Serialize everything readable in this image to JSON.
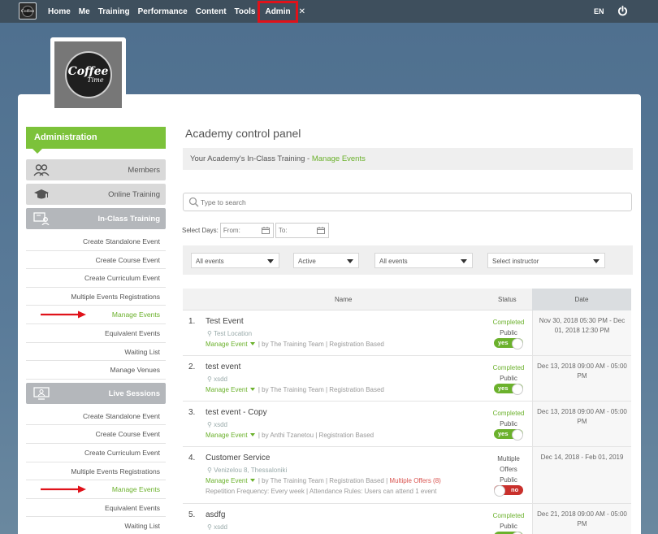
{
  "topbar": {
    "logo_text": "Coffee",
    "nav": [
      "Home",
      "Me",
      "Training",
      "Performance",
      "Content",
      "Tools"
    ],
    "admin": "Admin",
    "lang": "EN"
  },
  "profile": {
    "logo_line1": "Coffee",
    "logo_line2": "Time"
  },
  "sidebar": {
    "title": "Administration",
    "sections": {
      "members": "Members",
      "online": "Online Training",
      "inclass": "In-Class Training",
      "live": "Live Sessions"
    },
    "inclass_items": [
      "Create Standalone Event",
      "Create Course Event",
      "Create Curriculum Event",
      "Multiple Events Registrations",
      "Manage Events",
      "Equivalent Events",
      "Waiting List",
      "Manage Venues"
    ],
    "live_items": [
      "Create Standalone Event",
      "Create Course Event",
      "Create Curriculum Event",
      "Multiple Events Registrations",
      "Manage Events",
      "Equivalent Events",
      "Waiting List"
    ]
  },
  "main": {
    "title": "Academy control panel",
    "crumb_text": "Your Academy's In-Class Training - ",
    "crumb_link": "Manage Events",
    "search_placeholder": "Type to search",
    "select_days": "Select Days:",
    "from": "From:",
    "to": "To:",
    "filters": [
      "All events",
      "Active",
      "All events",
      "Select instructor"
    ]
  },
  "table": {
    "headers": {
      "name": "Name",
      "status": "Status",
      "date": "Date"
    },
    "rows": [
      {
        "num": "1.",
        "name": "Test Event",
        "location": "Test Location",
        "manage": "Manage Event",
        "by": " | by The Training Team | Registration Based",
        "extra": "",
        "freq": "",
        "status1": "Completed",
        "status2": "Public",
        "toggle": "yes",
        "date": "Nov 30, 2018 05:30 PM - Dec 01, 2018 12:30 PM"
      },
      {
        "num": "2.",
        "name": "test event",
        "location": "xsdd",
        "manage": "Manage Event",
        "by": " | by The Training Team | Registration Based",
        "extra": "",
        "freq": "",
        "status1": "Completed",
        "status2": "Public",
        "toggle": "yes",
        "date": "Dec 13, 2018 09:00 AM - 05:00 PM"
      },
      {
        "num": "3.",
        "name": "test event - Copy",
        "location": "xsdd",
        "manage": "Manage Event",
        "by": " | by Anthi Tzanetou | Registration Based",
        "extra": "",
        "freq": "",
        "status1": "Completed",
        "status2": "Public",
        "toggle": "yes",
        "date": "Dec 13, 2018 09:00 AM - 05:00 PM"
      },
      {
        "num": "4.",
        "name": "Customer Service",
        "location": "Venizelou 8, Thessaloniki",
        "manage": "Manage Event",
        "by": " | by The Training Team | Registration Based | ",
        "extra": "Multiple Offers (8)",
        "freq": "Repetition Frequency: Every week | Attendance Rules: Users can attend 1 event",
        "status1": "Multiple Offers",
        "status2": "Public",
        "toggle": "no",
        "date": "Dec 14, 2018 - Feb 01, 2019"
      },
      {
        "num": "5.",
        "name": "asdfg",
        "location": "xsdd",
        "manage": "",
        "by": "",
        "extra": "",
        "freq": "",
        "status1": "Completed",
        "status2": "Public",
        "toggle": "",
        "date": "Dec 21, 2018 09:00 AM - 05:00 PM"
      }
    ]
  }
}
